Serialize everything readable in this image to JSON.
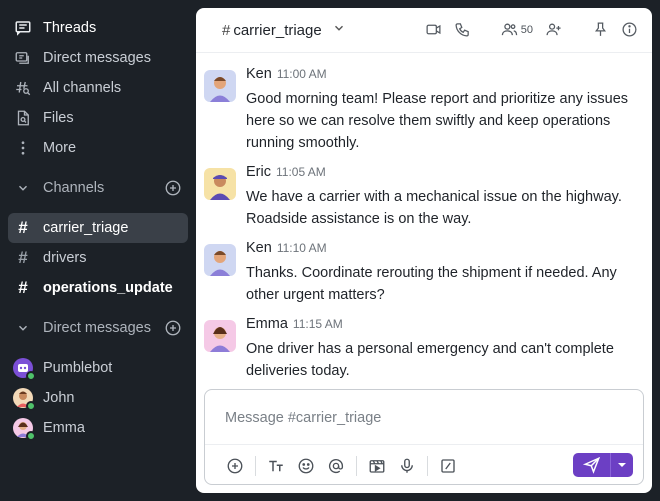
{
  "sidebar": {
    "nav": [
      {
        "label": "Threads",
        "icon": "threads-icon"
      },
      {
        "label": "Direct messages",
        "icon": "direct-messages-icon"
      },
      {
        "label": "All channels",
        "icon": "all-channels-icon"
      },
      {
        "label": "Files",
        "icon": "files-icon"
      },
      {
        "label": "More",
        "icon": "more-icon"
      }
    ],
    "channels_section": "Channels",
    "channels": [
      {
        "label": "carrier_triage",
        "active": true
      },
      {
        "label": "drivers",
        "active": false
      },
      {
        "label": "operations_update",
        "unread": true
      }
    ],
    "dm_section": "Direct messages",
    "dms": [
      {
        "label": "Pumblebot"
      },
      {
        "label": "John"
      },
      {
        "label": "Emma"
      }
    ]
  },
  "header": {
    "channel_name": "carrier_triage",
    "hash": "#",
    "member_count": "50"
  },
  "messages": [
    {
      "author": "Ken",
      "time": "11:00 AM",
      "text": "Good morning team! Please report and prioritize any issues here so we can resolve them swiftly and keep operations running smoothly."
    },
    {
      "author": "Eric",
      "time": "11:05 AM",
      "text": "We have a carrier with a mechanical issue on the highway. Roadside assistance is on the way."
    },
    {
      "author": "Ken",
      "time": "11:10 AM",
      "text": "Thanks. Coordinate rerouting the shipment if needed. Any other urgent matters?"
    },
    {
      "author": "Emma",
      "time": "11:15 AM",
      "text": "One driver has a personal emergency and can't complete deliveries today."
    }
  ],
  "composer": {
    "placeholder": "Message #carrier_triage"
  },
  "colors": {
    "sidebar_bg": "#1c2127",
    "accent": "#6c3fc4",
    "online": "#4fc26a"
  }
}
